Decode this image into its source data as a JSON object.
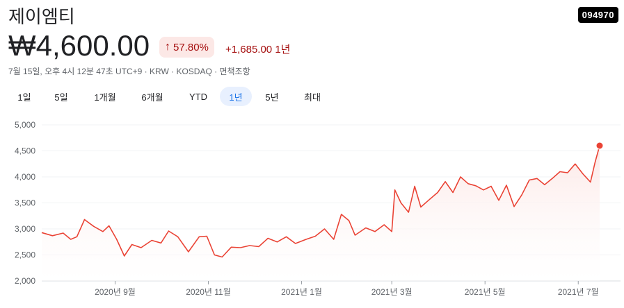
{
  "header": {
    "title": "제이엠티",
    "ticker": "094970",
    "price": "₩4,600.00",
    "change_pct": "57.80%",
    "change_abs": "+1,685.00 1년",
    "meta": "7월 15일, 오후 4시 12분 47초 UTC+9 · KRW · KOSDAQ · 면책조항"
  },
  "tabs": [
    {
      "label": "1일",
      "active": false
    },
    {
      "label": "5일",
      "active": false
    },
    {
      "label": "1개월",
      "active": false
    },
    {
      "label": "6개월",
      "active": false
    },
    {
      "label": "YTD",
      "active": false
    },
    {
      "label": "1년",
      "active": true
    },
    {
      "label": "5년",
      "active": false
    },
    {
      "label": "최대",
      "active": false
    }
  ],
  "colors": {
    "line": "#ea4335",
    "fill": "#fce8e6",
    "grid": "#f1f3f4",
    "axis": "#5f6368"
  },
  "chart_data": {
    "type": "area",
    "ylim": [
      2000,
      5000
    ],
    "yticks": [
      2000,
      2500,
      3000,
      3500,
      4000,
      4500,
      5000
    ],
    "xticks": [
      {
        "label": "2020년 9월",
        "date": "2020-09-01"
      },
      {
        "label": "2020년 11월",
        "date": "2020-11-01"
      },
      {
        "label": "2021년 1월",
        "date": "2021-01-01"
      },
      {
        "label": "2021년 3월",
        "date": "2021-03-01"
      },
      {
        "label": "2021년 5월",
        "date": "2021-05-01"
      },
      {
        "label": "2021년 7월",
        "date": "2021-07-01"
      }
    ],
    "series": [
      {
        "x": [
          "2020-07-15",
          "2020-07-22",
          "2020-07-29",
          "2020-08-03",
          "2020-08-07",
          "2020-08-12",
          "2020-08-18",
          "2020-08-24",
          "2020-08-28",
          "2020-09-02",
          "2020-09-07",
          "2020-09-12",
          "2020-09-18",
          "2020-09-25",
          "2020-10-01",
          "2020-10-06",
          "2020-10-12",
          "2020-10-19",
          "2020-10-26",
          "2020-10-31",
          "2020-11-05",
          "2020-11-10",
          "2020-11-16",
          "2020-11-22",
          "2020-11-28",
          "2020-12-04",
          "2020-12-10",
          "2020-12-16",
          "2020-12-22",
          "2020-12-28",
          "2021-01-04",
          "2021-01-10",
          "2021-01-16",
          "2021-01-22",
          "2021-01-27",
          "2021-02-01",
          "2021-02-05",
          "2021-02-12",
          "2021-02-18",
          "2021-02-24",
          "2021-03-01",
          "2021-03-03",
          "2021-03-07",
          "2021-03-12",
          "2021-03-16",
          "2021-03-20",
          "2021-03-25",
          "2021-03-31",
          "2021-04-05",
          "2021-04-10",
          "2021-04-15",
          "2021-04-20",
          "2021-04-25",
          "2021-04-30",
          "2021-05-05",
          "2021-05-10",
          "2021-05-15",
          "2021-05-20",
          "2021-05-25",
          "2021-05-30",
          "2021-06-04",
          "2021-06-09",
          "2021-06-14",
          "2021-06-19",
          "2021-06-24",
          "2021-06-29",
          "2021-07-04",
          "2021-07-09",
          "2021-07-12",
          "2021-07-15"
        ],
        "y": [
          2930,
          2870,
          2920,
          2800,
          2850,
          3180,
          3050,
          2950,
          3060,
          2800,
          2480,
          2700,
          2640,
          2780,
          2730,
          2960,
          2850,
          2560,
          2850,
          2860,
          2500,
          2460,
          2650,
          2640,
          2680,
          2660,
          2820,
          2750,
          2850,
          2720,
          2800,
          2860,
          3000,
          2800,
          3280,
          3160,
          2880,
          3020,
          2950,
          3080,
          2950,
          3750,
          3500,
          3320,
          3820,
          3420,
          3550,
          3700,
          3910,
          3700,
          4000,
          3870,
          3830,
          3750,
          3820,
          3550,
          3840,
          3430,
          3650,
          3940,
          3970,
          3850,
          3970,
          4100,
          4080,
          4250,
          4060,
          3900,
          4280,
          4600
        ]
      }
    ]
  }
}
